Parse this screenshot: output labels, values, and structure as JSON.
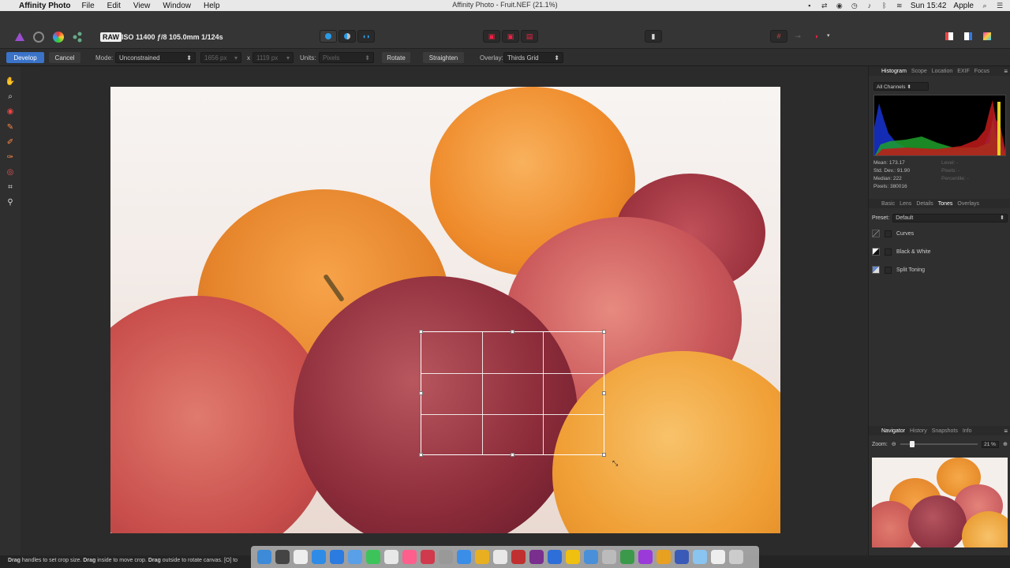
{
  "menubar": {
    "app_name": "Affinity Photo",
    "menus": [
      "File",
      "Edit",
      "View",
      "Window",
      "Help"
    ],
    "window_title": "Affinity Photo - Fruit.NEF (21.1%)",
    "clock": "Sun 15:42",
    "user": "Apple"
  },
  "toolbar": {
    "raw_badge": "RAW",
    "exif": "ISO 11400 ƒ/8 105.0mm 1/124s"
  },
  "context": {
    "develop_label": "Develop",
    "cancel_label": "Cancel",
    "mode_label": "Mode:",
    "mode_value": "Unconstrained",
    "width_value": "1656 px",
    "x_label": "x",
    "height_value": "1119 px",
    "units_label": "Units:",
    "units_value": "Pixels",
    "rotate_label": "Rotate",
    "straighten_label": "Straighten",
    "overlay_label": "Overlay:",
    "overlay_value": "Thirds Grid"
  },
  "histogram_panel": {
    "tabs": [
      "Histogram",
      "Scope",
      "Location",
      "EXIF",
      "Focus"
    ],
    "active_tab": "Histogram",
    "channel_select": "All Channels",
    "stats_left": [
      "Mean: 173.17",
      "Std. Dev.: 91.90",
      "Median: 222",
      "Pixels: 380016"
    ],
    "stats_right": [
      "Level: -",
      "Pixels: -",
      "Percentile: -"
    ]
  },
  "adjust_panel": {
    "tabs": [
      "Basic",
      "Lens",
      "Details",
      "Tones",
      "Overlays"
    ],
    "active_tab": "Tones",
    "preset_label": "Preset:",
    "preset_value": "Default",
    "items": [
      "Curves",
      "Black & White",
      "Split Toning"
    ]
  },
  "navigator_panel": {
    "tabs": [
      "Navigator",
      "History",
      "Snapshots",
      "Info"
    ],
    "active_tab": "Navigator",
    "zoom_label": "Zoom:",
    "zoom_value": "21 %",
    "zoom_level": 0.12
  },
  "statusbar": {
    "hint_parts": [
      {
        "bold": "Drag",
        "text": " handles to set crop size. "
      },
      {
        "bold": "Drag",
        "text": " inside to move crop. "
      },
      {
        "bold": "Drag",
        "text": " outside to rotate canvas. [O] to"
      }
    ]
  },
  "dock": {
    "app_colors": [
      "#3c8ad8",
      "#444",
      "#eee",
      "#2e8be6",
      "#2b7be0",
      "#5aa0e8",
      "#3cc45a",
      "#e8e8e8",
      "#ff5f8c",
      "#d03a4c",
      "#999",
      "#3a8ee8",
      "#e8b020",
      "#e8e8e8",
      "#c03030",
      "#7a2e8e",
      "#2e6ed8",
      "#f0c010",
      "#4a90d8",
      "#bbb",
      "#3a9a4a",
      "#9a3ad8",
      "#e8a020",
      "#3a5ab8",
      "#8ac4f0",
      "#eee",
      "#ccc"
    ]
  }
}
